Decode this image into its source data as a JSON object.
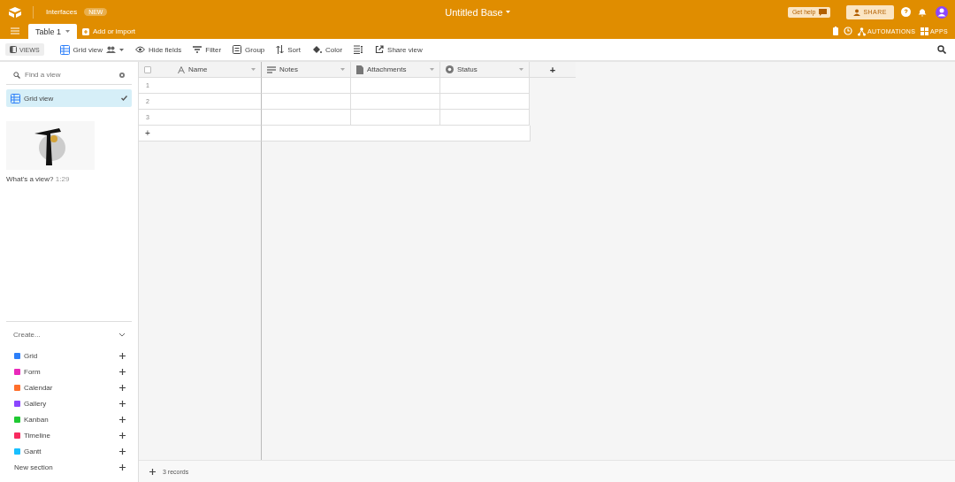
{
  "header": {
    "interfaces_link": "Interfaces",
    "badge": "NEW",
    "base_title": "Untitled Base",
    "help_button": "Get help",
    "share_button": "SHARE",
    "automations": "AUTOMATIONS",
    "apps": "APPS"
  },
  "tabs": [
    {
      "label": "Table 1",
      "selected": true
    }
  ],
  "add_import": "Add or import",
  "toolbar": {
    "views_toggle": "VIEWS",
    "view_name": "Grid view",
    "tools": [
      {
        "kind": "hide",
        "label": "Hide fields"
      },
      {
        "kind": "filter",
        "label": "Filter"
      },
      {
        "kind": "group",
        "label": "Group"
      },
      {
        "kind": "sort",
        "label": "Sort"
      },
      {
        "kind": "color",
        "label": "Color"
      },
      {
        "kind": "row-height"
      },
      {
        "kind": "share",
        "label": "Share view"
      }
    ]
  },
  "sidebar": {
    "search": {
      "placeholder": "Find a view"
    },
    "views": [
      {
        "label": "Grid view",
        "selected": true
      }
    ],
    "video": {
      "caption": "What's a view?",
      "duration": "1:29"
    },
    "create_label": "Create...",
    "create_items": [
      {
        "label": "Grid",
        "color": "#2d7ff9"
      },
      {
        "label": "Form",
        "color": "#e929ba"
      },
      {
        "label": "Calendar",
        "color": "#ff6f2c"
      },
      {
        "label": "Gallery",
        "color": "#8b46ff"
      },
      {
        "label": "Kanban",
        "color": "#20c933"
      },
      {
        "label": "Timeline",
        "color": "#f82b60"
      },
      {
        "label": "Gantt",
        "color": "#18bfff"
      }
    ],
    "new_section": "New section"
  },
  "grid": {
    "columns": [
      {
        "kind": "text",
        "name": "Name"
      },
      {
        "kind": "long-text",
        "name": "Notes"
      },
      {
        "kind": "attachment",
        "name": "Attachments"
      },
      {
        "kind": "select",
        "name": "Status"
      }
    ],
    "select_all_checked": false,
    "rows": [
      "1",
      "2",
      "3"
    ],
    "add_row": "+",
    "add_column": "+",
    "records": "3 records"
  }
}
